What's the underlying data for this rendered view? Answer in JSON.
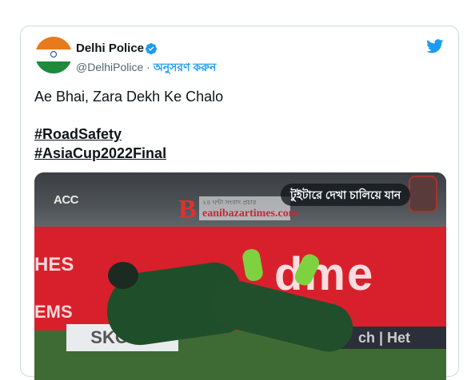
{
  "tweet": {
    "author_name": "Delhi Police",
    "handle": "@DelhiPolice",
    "separator": "·",
    "follow_label": "অনুসরণ করুন",
    "text": "Ae Bhai, Zara Dekh Ke Chalo",
    "hashtags": [
      "#RoadSafety",
      "#AsiaCup2022Final"
    ]
  },
  "media": {
    "overlay_button": "টুইটারে দেখা চালিয়ে যান",
    "acc_logo": "ACC",
    "banner_left_1": "HES",
    "banner_left_2": "EMS",
    "banner_big": "dme",
    "board_left": "SKODA",
    "board_right": "ch | Het",
    "watermark_letter": "B",
    "watermark_tagline": "২৪ ঘন্টা সংবাদ প্রচার",
    "watermark_site": "eanibazartimes.com"
  },
  "colors": {
    "accent": "#1d9bf0",
    "text": "#0f1419",
    "muted": "#536471",
    "border": "#cfd9de"
  },
  "icons": {
    "verified": "verified-badge-icon",
    "brand": "twitter-bird-icon"
  }
}
